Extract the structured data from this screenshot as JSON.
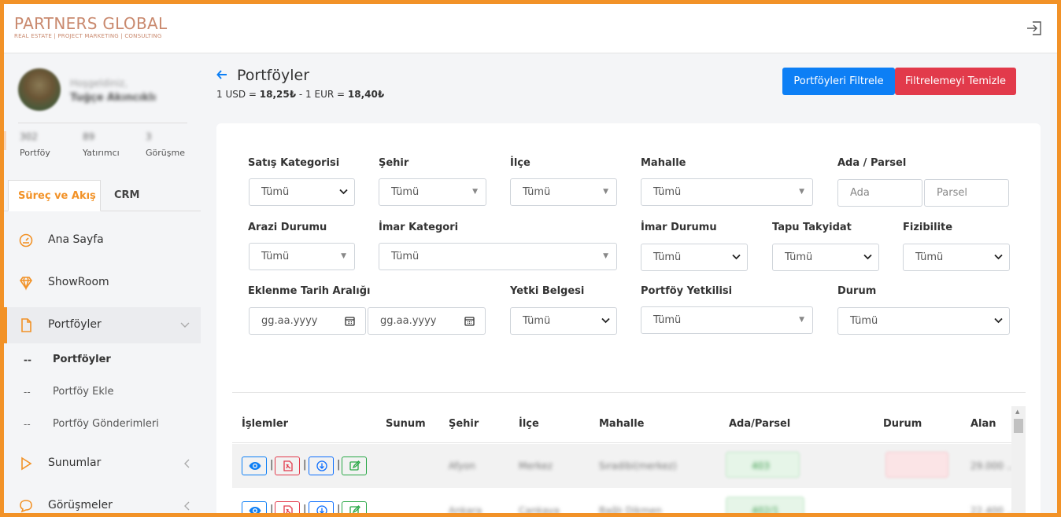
{
  "brand": {
    "title": "PARTNERS GLOBAL",
    "subtitle": "REAL ESTATE | PROJECT MARKETING | CONSULTING",
    "color": "#c9896e"
  },
  "header": {
    "logout_icon": "logout-icon"
  },
  "profile": {
    "greeting": "Hoşgeldiniz,",
    "name": "Tuğçe Akıncıklı"
  },
  "stats": [
    {
      "value": "302",
      "label": "Portföy"
    },
    {
      "value": "89",
      "label": "Yatırımcı"
    },
    {
      "value": "3",
      "label": "Görüşme"
    }
  ],
  "tabs": {
    "active": "Süreç ve Akış",
    "inactive": "CRM"
  },
  "menu": {
    "home": "Ana Sayfa",
    "showroom": "ShowRoom",
    "portfolios": "Portföyler",
    "sub": [
      "Portföyler",
      "Portföy Ekle",
      "Portföy Gönderimleri"
    ],
    "dash": "--",
    "presentations": "Sunumlar",
    "meetings": "Görüşmeler"
  },
  "page": {
    "title": "Portföyler",
    "rate_usd_label": "1 USD = ",
    "rate_usd": "18,25₺",
    "rate_sep": " - 1 EUR = ",
    "rate_eur": "18,40₺"
  },
  "buttons": {
    "filter": "Portföyleri Filtrele",
    "clear": "Filtrelemeyi Temizle"
  },
  "filters": {
    "sales_category": {
      "label": "Satış Kategorisi",
      "value": "Tümü"
    },
    "city": {
      "label": "Şehir",
      "value": "Tümü"
    },
    "district": {
      "label": "İlçe",
      "value": "Tümü"
    },
    "neighborhood": {
      "label": "Mahalle",
      "value": "Tümü"
    },
    "block_parcel": {
      "label": "Ada / Parsel",
      "block_placeholder": "Ada",
      "parcel_placeholder": "Parsel"
    },
    "land_status": {
      "label": "Arazi Durumu",
      "value": "Tümü"
    },
    "zoning_category": {
      "label": "İmar Kategori",
      "value": "Tümü"
    },
    "zoning_status": {
      "label": "İmar Durumu",
      "value": "Tümü"
    },
    "deed_restriction": {
      "label": "Tapu Takyidat",
      "value": "Tümü"
    },
    "feasibility": {
      "label": "Fizibilite",
      "value": "Tümü"
    },
    "date_range": {
      "label": "Eklenme Tarih Aralığı",
      "start_placeholder": "gg.aa.yyyy",
      "end_placeholder": "gg.aa.yyyy"
    },
    "authority_doc": {
      "label": "Yetki Belgesi",
      "value": "Tümü"
    },
    "portfolio_agent": {
      "label": "Portföy Yetkilisi",
      "value": "Tümü"
    },
    "status": {
      "label": "Durum",
      "value": "Tümü"
    }
  },
  "table": {
    "columns": [
      "İşlemler",
      "Sunum",
      "Şehir",
      "İlçe",
      "Mahalle",
      "Ada/Parsel",
      "Durum",
      "Alan"
    ],
    "rows": [
      {
        "city": "Afyon",
        "district": "Merkez",
        "neighborhood": "Sıradibi(merkez)",
        "parcel": "403",
        "area": "29.000 ..."
      },
      {
        "city": "Ankara",
        "district": "Çankaya",
        "neighborhood": "Bağlı Dikmen",
        "parcel": "402/1",
        "area": "22.400 ..."
      }
    ],
    "separator": "|"
  },
  "colors": {
    "accent": "#f29227",
    "primary": "#0d7ff5",
    "danger": "#e23a4b",
    "view": "#0d7ff5",
    "pdf": "#e23a4b",
    "download": "#0d6efd",
    "edit": "#28a745"
  }
}
